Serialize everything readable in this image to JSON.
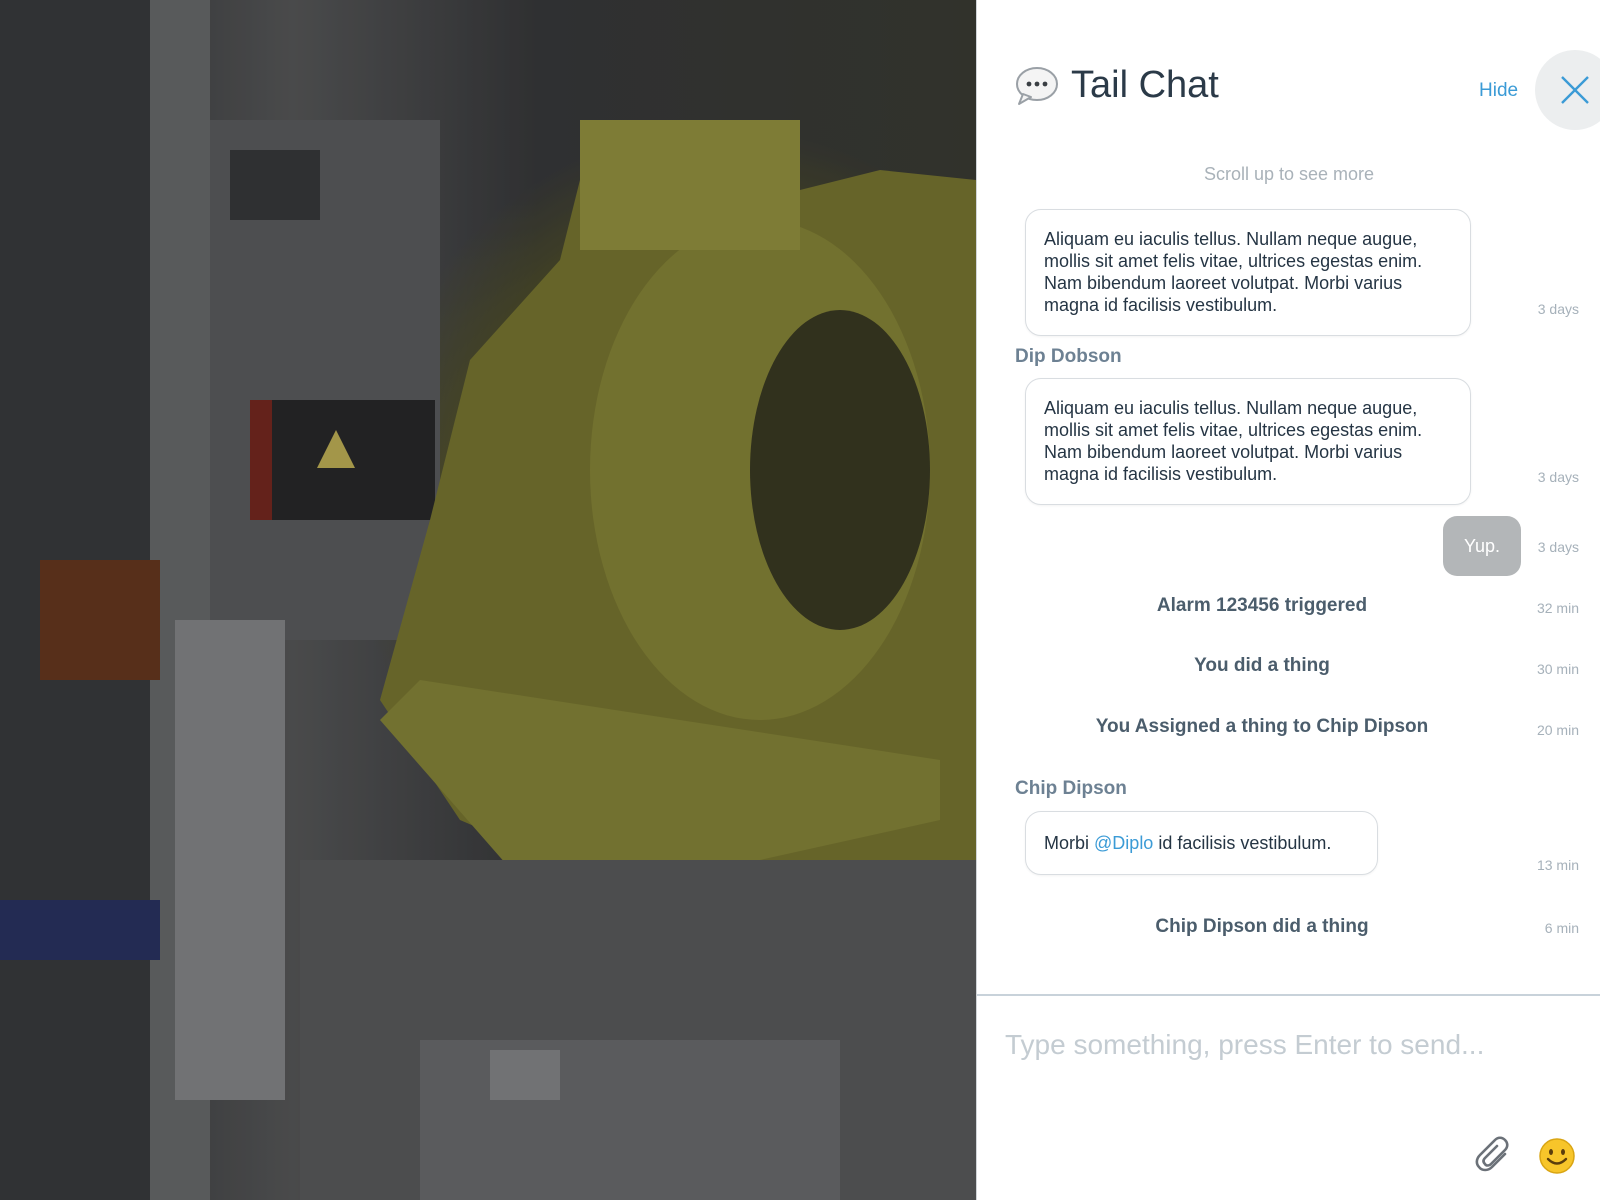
{
  "chat": {
    "title": "Tail Chat",
    "hide_label": "Hide",
    "scroll_hint": "Scroll up to see more",
    "messages": [
      {
        "text": "Aliquam eu iaculis tellus. Nullam neque augue, mollis sit amet felis vitae, ultrices egestas enim. Nam bibendum laoreet volutpat. Morbi varius magna id facilisis vestibulum.",
        "time": "3 days"
      },
      {
        "sender": "Dip Dobson",
        "text": "Aliquam eu iaculis tellus. Nullam neque augue, mollis sit amet felis vitae, ultrices egestas enim. Nam bibendum laoreet volutpat. Morbi varius magna id facilisis vestibulum.",
        "time": "3 days"
      },
      {
        "text": "Yup.",
        "time": "3 days",
        "own": true
      },
      {
        "event": "Alarm 123456 triggered",
        "time": "32 min"
      },
      {
        "event": "You did a thing",
        "time": "30 min"
      },
      {
        "event": "You Assigned a thing to Chip Dipson",
        "time": "20 min"
      },
      {
        "sender": "Chip Dipson",
        "text_before": "Morbi",
        "mention": "@Diplo",
        "text_after": "id facilisis vestibulum.",
        "time": "13 min"
      },
      {
        "event": "Chip Dipson did a thing",
        "time": "6 min"
      }
    ],
    "composer_placeholder": "Type something, press Enter to send...",
    "icons": {
      "chat": "chat-bubble-icon",
      "close": "close-icon",
      "attach": "paperclip-icon",
      "emoji": "smiley-icon"
    },
    "colors": {
      "accent": "#3b9bd6",
      "title": "#2b3a48",
      "sender": "#6d8193",
      "own_bubble": "#b3b6b8"
    }
  }
}
